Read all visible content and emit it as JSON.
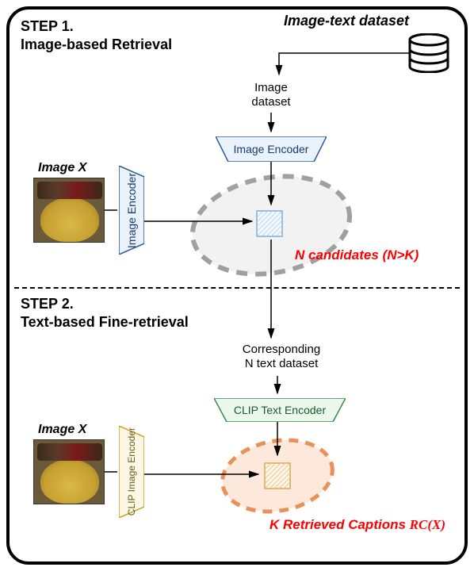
{
  "header": {
    "dataset_title": "Image-text dataset"
  },
  "step1": {
    "title_line1": "STEP 1.",
    "title_line2": "Image-based Retrieval",
    "image_dataset_label": "Image\ndataset",
    "encoder_main": "Image Encoder",
    "image_x_label": "Image X",
    "encoder_side": "Image Encoder",
    "candidates_label": "N candidates (N>K)"
  },
  "step2": {
    "title_line1": "STEP 2.",
    "title_line2": "Text-based Fine-retrieval",
    "corresponding_label": "Corresponding\nN text dataset",
    "text_encoder": "CLIP Text Encoder",
    "image_x_label": "Image X",
    "clip_image_encoder": "CLIP Image Encoder",
    "retrieved_label_prefix": "K Retrieved Captions ",
    "retrieved_formula": "RC(X)"
  }
}
